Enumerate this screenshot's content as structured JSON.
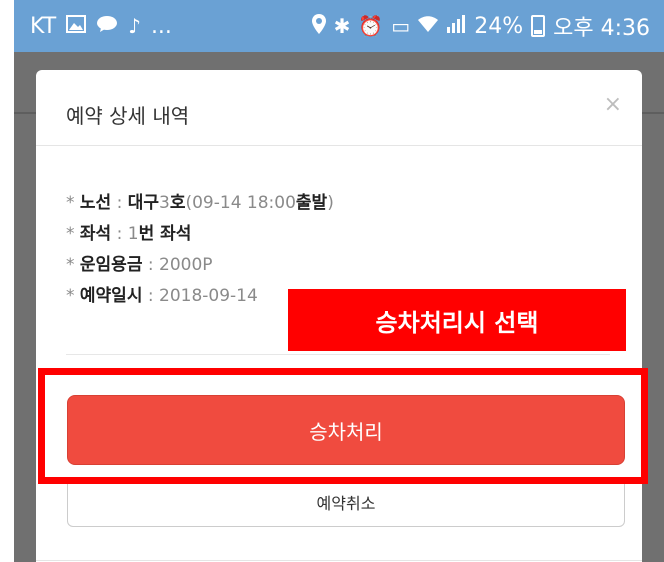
{
  "statusbar": {
    "carrier": "KT",
    "left_icons": [
      "gallery-icon",
      "talk-icon",
      "music-icon"
    ],
    "more": "...",
    "battery": "24%",
    "time": "오후 4:36"
  },
  "modal": {
    "title": "예약 상세 내역",
    "close": "×",
    "details": {
      "route_label": "노선",
      "route_city": "대구",
      "route_num": "3",
      "route_suffix": "호",
      "route_time_open": "(09-14 18:00",
      "route_depart": "출발",
      "route_close": ")",
      "seat_label": "좌석",
      "seat_num": "1",
      "seat_suffix": "번 좌석",
      "fare_label": "운임용금",
      "fare_value": "2000P",
      "resv_label": "예약일시",
      "resv_value": "2018-09-14"
    },
    "board_button": "승차처리",
    "cancel_button": "예약취소"
  },
  "annotation": {
    "callout_text": "승차처리시 선택",
    "color": "#ff0000"
  },
  "colors": {
    "statusbar": "#6aa1d4",
    "board_button": "#f04b3f",
    "overlay": "#707070"
  }
}
